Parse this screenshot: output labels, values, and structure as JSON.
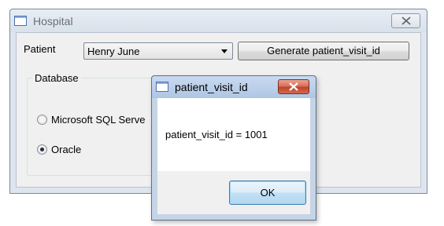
{
  "main_window": {
    "title": "Hospital",
    "patient_label": "Patient",
    "patient_select_value": "Henry June",
    "generate_button_label": "Generate patient_visit_id",
    "database_group": {
      "legend": "Database",
      "options": [
        {
          "label": "Microsoft SQL Serve",
          "selected": false
        },
        {
          "label": "Oracle",
          "selected": true
        }
      ]
    }
  },
  "dialog": {
    "title": "patient_visit_id",
    "message": "patient_visit_id = 1001",
    "ok_label": "OK"
  },
  "icons": {
    "window_icon": "window-icon",
    "close": "close-icon",
    "dropdown": "chevron-down-icon"
  },
  "colors": {
    "dialog_close_red": "#c0432a",
    "ok_button_blue": "#3c7fb1",
    "titlebar_active": "#aec6e4"
  }
}
